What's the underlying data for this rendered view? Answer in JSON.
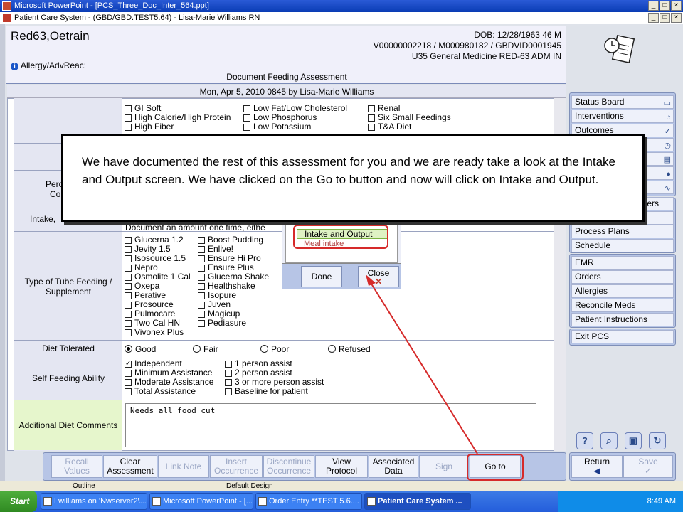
{
  "window": {
    "ppt_title": "Microsoft PowerPoint - [PCS_Three_Doc_Inter_564.ppt]",
    "app_title": "Patient Care System - (GBD/GBD.TEST5.64) - Lisa-Marie Williams RN"
  },
  "patient": {
    "name": "Red63,Oetrain",
    "dob": "DOB: 12/28/1963 46 M",
    "ids": "V00000002218 / M000980182 / GBDVID0001945",
    "location": "U35 General Medicine  RED-63  ADM IN",
    "allergy_label": "Allergy/AdvReac:",
    "document_title": "Document Feeding Assessment"
  },
  "form": {
    "header": "Mon,  Apr 5, 2010 0845   by  Lisa-Marie Williams",
    "diet_col1": [
      "GI Soft",
      "High Calorie/High Protein",
      "High Fiber"
    ],
    "diet_col2": [
      "Low Fat/Low Cholesterol",
      "Low Phosphorus",
      "Low Potassium"
    ],
    "diet_col3": [
      "Renal",
      "Six Small Feedings",
      "T&A Diet"
    ],
    "label_perc_1": "Perc",
    "label_perc_2": "Co",
    "label_intake": "Intake,",
    "intake_note": "Document an amount one time, eithe",
    "tube_label": "Type of Tube Feeding / Supplement",
    "tube_col1": [
      "Glucerna 1.2",
      "Jevity 1.5",
      "Isosource 1.5",
      "Nepro",
      "Osmolite 1 Cal",
      "Oxepa",
      "Perative",
      "Prosource",
      "Pulmocare",
      "Two Cal HN",
      "Vivonex Plus"
    ],
    "tube_col2": [
      "Boost Pudding",
      "Enlive!",
      "Ensure Hi Pro",
      "Ensure Plus",
      "Glucerna Shake",
      "Healthshake",
      "Isopure",
      "Juven",
      "Magicup",
      "Pediasure"
    ],
    "diet_tolerated_label": "Diet Tolerated",
    "diet_tolerated_options": [
      "Good",
      "Fair",
      "Poor",
      "Refused"
    ],
    "self_feeding_label": "Self Feeding Ability",
    "self_col1": [
      "Independent",
      "Minimum Assistance",
      "Moderate Assistance",
      "Total Assistance"
    ],
    "self_col2": [
      "1 person assist",
      "2 person assist",
      "3 or more person assist",
      "Baseline for patient"
    ],
    "comments_label": "Additional Diet Comments",
    "comments_value": "Needs all food cut"
  },
  "nav": {
    "group1": [
      "Status Board",
      "Interventions",
      "Outcomes"
    ],
    "providers_fragment": "iders",
    "group2": [
      "Process Plans",
      "Schedule"
    ],
    "group3": [
      "EMR",
      "Orders",
      "Allergies",
      "Reconcile Meds",
      "Patient Instructions"
    ],
    "exit": "Exit PCS",
    "return_label": "Return",
    "save_label": "Save"
  },
  "toolbar": {
    "recall": "Recall Values",
    "clear": "Clear Assessment",
    "link": "Link Note",
    "insert": "Insert Occurrence",
    "discontinue": "Discontinue Occurrence",
    "view": "View Protocol",
    "associated": "Associated Data",
    "sign": "Sign",
    "goto": "Go to"
  },
  "popup": {
    "selected_item": "Intake and Output",
    "second_item": "Meal intake",
    "done": "Done",
    "close": "Close"
  },
  "callout": {
    "text": "We have documented the rest of this assessment for you and we are ready take a look at the Intake and Output screen. We have clicked on the Go to button and now will click on Intake and Output."
  },
  "statusbar": {
    "outline": "Outline",
    "design": "Default Design"
  },
  "taskbar": {
    "start": "Start",
    "tasks": [
      "Lwilliams on 'Nwserver2\\...",
      "Microsoft PowerPoint - [...",
      "Order Entry **TEST 5.6....",
      "Patient Care System ..."
    ],
    "clock": "8:49 AM"
  },
  "colors": {
    "highlight": "#d62a2a",
    "selection": "#dff2c4",
    "panel": "#b7c5e6"
  }
}
